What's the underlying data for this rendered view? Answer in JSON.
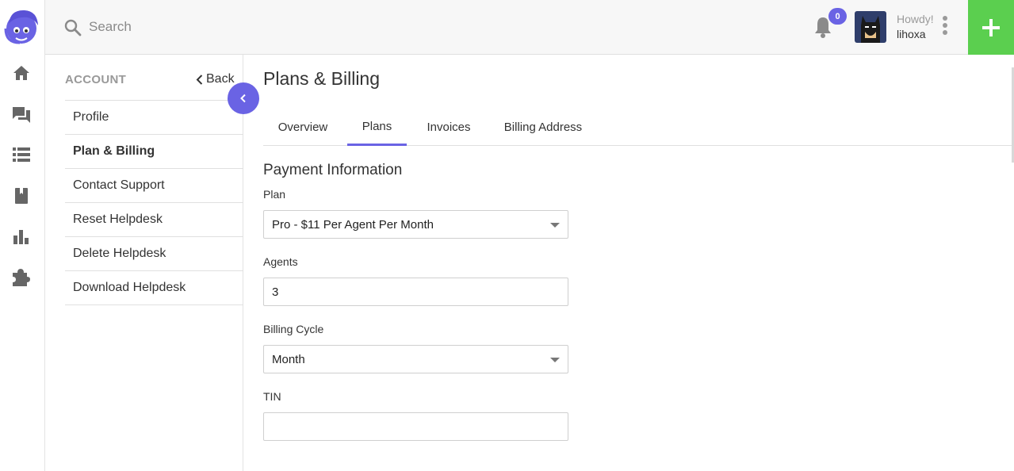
{
  "colors": {
    "accent": "#6a63e4",
    "add_button": "#5bcf4f",
    "topbar": "#f7f7f7"
  },
  "rail": {
    "logo_icon": "headset-mascot-logo",
    "items": [
      {
        "icon": "home-icon"
      },
      {
        "icon": "chat-icon"
      },
      {
        "icon": "list-icon"
      },
      {
        "icon": "book-icon"
      },
      {
        "icon": "bar-chart-icon"
      },
      {
        "icon": "puzzle-icon"
      }
    ]
  },
  "topbar": {
    "search_placeholder": "Search",
    "notification_count": "0",
    "greeting": "Howdy!",
    "username": "lihoxa",
    "add_icon": "plus-icon"
  },
  "account": {
    "title": "ACCOUNT",
    "back_label": "Back",
    "items": [
      {
        "label": "Profile",
        "active": false
      },
      {
        "label": "Plan & Billing",
        "active": true
      },
      {
        "label": "Contact Support",
        "active": false
      },
      {
        "label": "Reset Helpdesk",
        "active": false
      },
      {
        "label": "Delete Helpdesk",
        "active": false
      },
      {
        "label": "Download Helpdesk",
        "active": false
      }
    ]
  },
  "main": {
    "title": "Plans & Billing",
    "tabs": [
      {
        "label": "Overview",
        "active": false
      },
      {
        "label": "Plans",
        "active": true
      },
      {
        "label": "Invoices",
        "active": false
      },
      {
        "label": "Billing Address",
        "active": false
      }
    ],
    "section_title": "Payment Information",
    "form": {
      "plan_label": "Plan",
      "plan_value": "Pro - $11 Per Agent Per Month",
      "agents_label": "Agents",
      "agents_value": "3",
      "cycle_label": "Billing Cycle",
      "cycle_value": "Month",
      "tin_label": "TIN",
      "tin_value": ""
    }
  }
}
